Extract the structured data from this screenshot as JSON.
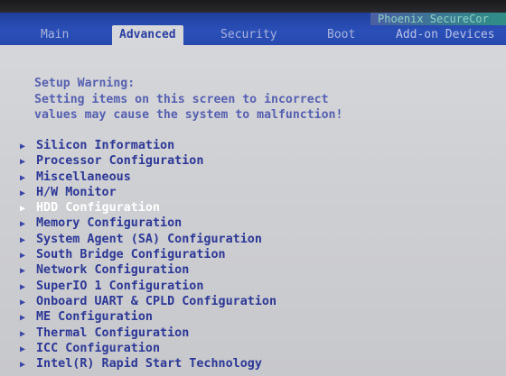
{
  "bios": {
    "brand": "Phoenix SecureCor",
    "tabs": [
      {
        "label": "Main"
      },
      {
        "label": "Advanced"
      },
      {
        "label": "Security"
      },
      {
        "label": "Boot"
      },
      {
        "label": "Add-on Devices"
      }
    ],
    "active_tab": "Advanced",
    "warning": {
      "title": "Setup Warning:",
      "line1": "Setting items on this screen to incorrect",
      "line2": "values may cause the system to malfunction!"
    },
    "menu_items": [
      {
        "label": "Silicon Information"
      },
      {
        "label": "Processor Configuration"
      },
      {
        "label": "Miscellaneous"
      },
      {
        "label": "H/W Monitor"
      },
      {
        "label": "HDD Configuration"
      },
      {
        "label": "Memory Configuration"
      },
      {
        "label": "System Agent (SA) Configuration"
      },
      {
        "label": "South Bridge Configuration"
      },
      {
        "label": "Network Configuration"
      },
      {
        "label": "SuperIO 1 Configuration"
      },
      {
        "label": "Onboard UART & CPLD Configuration"
      },
      {
        "label": "ME Configuration"
      },
      {
        "label": "Thermal Configuration"
      },
      {
        "label": "ICC Configuration"
      },
      {
        "label": "Intel(R) Rapid Start Technology"
      }
    ],
    "selected_item": "HDD Configuration",
    "submenu_icon": "right-triangle-icon",
    "colors": {
      "menubar": "#2a4fb8",
      "background": "#cfd0d4",
      "item_text": "#2c3796",
      "selected_text": "#ffffff",
      "warning_text": "#5660b0"
    }
  }
}
